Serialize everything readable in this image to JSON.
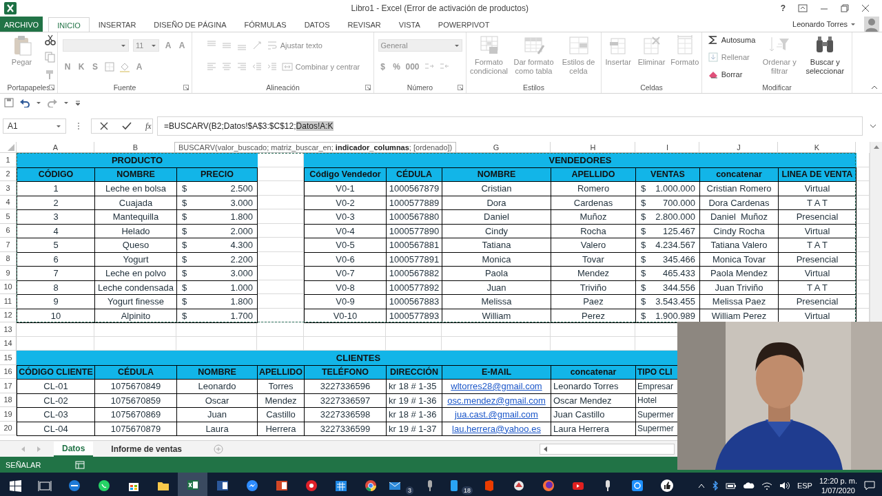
{
  "window": {
    "title": "Libro1 - Excel (Error de activación de productos)",
    "help": "?",
    "user": "Leonardo Torres"
  },
  "ribbon_tabs": [
    {
      "label": "ARCHIVO",
      "kind": "file",
      "selected": false
    },
    {
      "label": "INICIO",
      "kind": "tab",
      "selected": true
    },
    {
      "label": "INSERTAR",
      "kind": "tab",
      "selected": false
    },
    {
      "label": "DISEÑO DE PÁGINA",
      "kind": "tab",
      "selected": false
    },
    {
      "label": "FÓRMULAS",
      "kind": "tab",
      "selected": false
    },
    {
      "label": "DATOS",
      "kind": "tab",
      "selected": false
    },
    {
      "label": "REVISAR",
      "kind": "tab",
      "selected": false
    },
    {
      "label": "VISTA",
      "kind": "tab",
      "selected": false
    },
    {
      "label": "POWERPIVOT",
      "kind": "tab",
      "selected": false
    }
  ],
  "ribbon": [
    {
      "label": "Portapapeles",
      "blocks": [
        {
          "kind": "large",
          "label": "Pegar",
          "disabled": true
        },
        {
          "kind": "stack",
          "lines": [
            {
              "items": [
                {
                  "kind": "icon",
                  "disabled": false
                }
              ]
            },
            {
              "items": [
                {
                  "kind": "icon",
                  "disabled": true
                }
              ]
            },
            {
              "items": [
                {
                  "kind": "icon",
                  "disabled": true
                }
              ]
            }
          ]
        }
      ]
    },
    {
      "label": "Fuente",
      "blocks": [
        {
          "kind": "stack",
          "lines": [
            {
              "items": [
                {
                  "kind": "field",
                  "disabled": true
                },
                {
                  "kind": "field",
                  "value": "11",
                  "disabled": true
                },
                {
                  "kind": "text",
                  "label": "A",
                  "disabled": true
                },
                {
                  "kind": "text",
                  "label": "A",
                  "disabled": true
                }
              ]
            },
            {
              "items": [
                {
                  "kind": "text",
                  "label": "N",
                  "disabled": true
                },
                {
                  "kind": "text",
                  "label": "K",
                  "disabled": true
                },
                {
                  "kind": "text",
                  "label": "S",
                  "disabled": true
                },
                {
                  "kind": "icon",
                  "disabled": true
                },
                {
                  "kind": "icon",
                  "disabled": true
                },
                {
                  "kind": "text",
                  "label": "A",
                  "disabled": true
                }
              ]
            }
          ]
        }
      ]
    },
    {
      "label": "Alineación",
      "blocks": [
        {
          "kind": "stack",
          "lines": [
            {
              "items": [
                {
                  "kind": "icon",
                  "disabled": true
                },
                {
                  "kind": "icon",
                  "disabled": true
                },
                {
                  "kind": "icon",
                  "disabled": true
                },
                {
                  "kind": "icon",
                  "disabled": true
                },
                {
                  "kind": "small",
                  "label": "Ajustar texto",
                  "disabled": true
                }
              ]
            },
            {
              "items": [
                {
                  "kind": "icon",
                  "disabled": true
                },
                {
                  "kind": "icon",
                  "disabled": true
                },
                {
                  "kind": "icon",
                  "disabled": true
                },
                {
                  "kind": "icon",
                  "disabled": true
                },
                {
                  "kind": "icon",
                  "disabled": true
                },
                {
                  "kind": "small",
                  "label": "Combinar y centrar",
                  "disabled": true
                }
              ]
            }
          ]
        }
      ]
    },
    {
      "label": "Número",
      "blocks": [
        {
          "kind": "stack",
          "lines": [
            {
              "items": [
                {
                  "kind": "field",
                  "value": "General",
                  "disabled": true
                }
              ]
            },
            {
              "items": [
                {
                  "kind": "text",
                  "label": "$",
                  "disabled": true
                },
                {
                  "kind": "text",
                  "label": "%",
                  "disabled": true
                },
                {
                  "kind": "text",
                  "label": "000",
                  "disabled": true
                },
                {
                  "kind": "icon",
                  "disabled": true
                },
                {
                  "kind": "icon",
                  "disabled": true
                }
              ]
            }
          ]
        }
      ]
    },
    {
      "label": "Estilos",
      "blocks": [
        {
          "kind": "large",
          "label": "Formato condicional",
          "disabled": true
        },
        {
          "kind": "large",
          "label": "Dar formato como tabla",
          "disabled": true
        },
        {
          "kind": "large",
          "label": "Estilos de celda",
          "disabled": true
        }
      ]
    },
    {
      "label": "Celdas",
      "blocks": [
        {
          "kind": "large",
          "label": "Insertar",
          "disabled": true
        },
        {
          "kind": "large",
          "label": "Eliminar",
          "disabled": true
        },
        {
          "kind": "large",
          "label": "Formato",
          "disabled": true
        }
      ]
    },
    {
      "label": "Modificar",
      "blocks": [
        {
          "kind": "stack",
          "lines": [
            {
              "items": [
                {
                  "kind": "small",
                  "label": "Autosuma",
                  "disabled": false
                }
              ]
            },
            {
              "items": [
                {
                  "kind": "small",
                  "label": "Rellenar",
                  "disabled": true
                }
              ]
            },
            {
              "items": [
                {
                  "kind": "small",
                  "label": "Borrar",
                  "disabled": false
                }
              ]
            }
          ]
        },
        {
          "kind": "large",
          "label": "Ordenar y filtrar",
          "disabled": true
        },
        {
          "kind": "large",
          "label": "Buscar y seleccionar",
          "disabled": false
        }
      ]
    }
  ],
  "formula_bar": {
    "name_box": "A1",
    "function_button": "fx",
    "formula": "=BUSCARV(B2;Datos!$A$3:$C$12;",
    "selected_text": "Datos!A:K"
  },
  "tooltip": "BUSCARV(valor_buscado; matriz_buscar_en; **indicador_columnas**; [ordenado])",
  "sheet": {
    "column_letters_left": [
      "A",
      "B"
    ],
    "column_letters_right": [
      "G",
      "H",
      "I",
      "J",
      "K"
    ],
    "row_numbers": [
      "1",
      "2",
      "3",
      "4",
      "5",
      "6",
      "7",
      "8",
      "9",
      "10",
      "11",
      "12",
      "13",
      "14",
      "15",
      "16",
      "17",
      "18",
      "19",
      "20"
    ],
    "copy_marquee": true,
    "tables": [
      {
        "title": "PRODUCTO",
        "columns": [
          {
            "label": "CÓDIGO",
            "kind": "centered"
          },
          {
            "label": "NOMBRE",
            "kind": "centered"
          },
          {
            "label": "PRECIO",
            "kind": "money"
          }
        ],
        "rows": [
          [
            "1",
            "Leche en bolsa",
            {
              "currency": "$",
              "amount": "2.500"
            }
          ],
          [
            "2",
            "Cuajada",
            {
              "currency": "$",
              "amount": "3.000"
            }
          ],
          [
            "3",
            "Mantequilla",
            {
              "currency": "$",
              "amount": "1.800"
            }
          ],
          [
            "4",
            "Helado",
            {
              "currency": "$",
              "amount": "2.000"
            }
          ],
          [
            "5",
            "Queso",
            {
              "currency": "$",
              "amount": "4.300"
            }
          ],
          [
            "6",
            "Yogurt",
            {
              "currency": "$",
              "amount": "2.200"
            }
          ],
          [
            "7",
            "Leche en polvo",
            {
              "currency": "$",
              "amount": "3.000"
            }
          ],
          [
            "8",
            "Leche condensada",
            {
              "currency": "$",
              "amount": "1.000"
            }
          ],
          [
            "9",
            "Yogurt finesse",
            {
              "currency": "$",
              "amount": "1.800"
            }
          ],
          [
            "10",
            "Alpinito",
            {
              "currency": "$",
              "amount": "1.700"
            }
          ]
        ]
      },
      {
        "title": "VENDEDORES",
        "columns": [
          {
            "label": "Código Vendedor",
            "kind": "centered"
          },
          {
            "label": "CÉDULA",
            "kind": "centered"
          },
          {
            "label": "NOMBRE",
            "kind": "centered"
          },
          {
            "label": "APELLIDO",
            "kind": "centered"
          },
          {
            "label": "VENTAS",
            "kind": "money"
          },
          {
            "label": "concatenar",
            "kind": "centered"
          },
          {
            "label": "LINEA DE VENTA",
            "kind": "centered"
          }
        ],
        "rows": [
          [
            "V0-1",
            "1000567879",
            "Cristian",
            "Romero",
            {
              "currency": "$",
              "amount": "1.000.000"
            },
            "Cristian Romero",
            "Virtual"
          ],
          [
            "V0-2",
            "1000577889",
            "Dora",
            "Cardenas",
            {
              "currency": "$",
              "amount": "700.000"
            },
            "Dora Cardenas",
            "T A T"
          ],
          [
            "V0-3",
            "1000567880",
            "Daniel",
            "Muñoz",
            {
              "currency": "$",
              "amount": "2.800.000"
            },
            "Daniel  Muñoz",
            "Presencial"
          ],
          [
            "V0-4",
            "1000577890",
            "Cindy",
            "Rocha",
            {
              "currency": "$",
              "amount": "125.467"
            },
            "Cindy Rocha",
            "Virtual"
          ],
          [
            "V0-5",
            "1000567881",
            "Tatiana",
            "Valero",
            {
              "currency": "$",
              "amount": "4.234.567"
            },
            "Tatiana Valero",
            "T A T"
          ],
          [
            "V0-6",
            "1000577891",
            "Monica",
            "Tovar",
            {
              "currency": "$",
              "amount": "345.466"
            },
            "Monica Tovar",
            "Presencial"
          ],
          [
            "V0-7",
            "1000567882",
            "Paola",
            "Mendez",
            {
              "currency": "$",
              "amount": "465.433"
            },
            "Paola Mendez",
            "Virtual"
          ],
          [
            "V0-8",
            "1000577892",
            "Juan",
            "Triviño",
            {
              "currency": "$",
              "amount": "344.556"
            },
            "Juan Triviño",
            "T A T"
          ],
          [
            "V0-9",
            "1000567883",
            "Melissa",
            "Paez",
            {
              "currency": "$",
              "amount": "3.543.455"
            },
            "Melissa Paez",
            "Presencial"
          ],
          [
            "V0-10",
            "1000577893",
            "William",
            "Perez",
            {
              "currency": "$",
              "amount": "1.900.989"
            },
            "William Perez",
            "Virtual"
          ]
        ]
      },
      {
        "title": "CLIENTES",
        "columns": [
          {
            "label": "CÓDIGO CLIENTE",
            "kind": "centered"
          },
          {
            "label": "CÉDULA",
            "kind": "centered"
          },
          {
            "label": "NOMBRE",
            "kind": "centered"
          },
          {
            "label": "APELLIDO",
            "kind": "centered"
          },
          {
            "label": "TELÉFONO",
            "kind": "centered"
          },
          {
            "label": "DIRECCIÓN",
            "kind": "left"
          },
          {
            "label": "E-MAIL",
            "kind": "link"
          },
          {
            "label": "concatenar",
            "kind": "left"
          },
          {
            "label": "TIPO CLI",
            "kind": "left"
          }
        ],
        "rows": [
          [
            "CL-01",
            "1075670849",
            "Leonardo",
            "Torres",
            "3227336596",
            "kr 18 # 1-35",
            "wltorres28@gmail.com",
            "Leonardo Torres",
            "Empresar"
          ],
          [
            "CL-02",
            "1075670859",
            "Oscar",
            "Mendez",
            "3227336597",
            "kr 19 # 1-36",
            "osc.mendez@gmail.com",
            "Oscar Mendez",
            "Hotel"
          ],
          [
            "CL-03",
            "1075670869",
            "Juan",
            "Castillo",
            "3227336598",
            "kr 18 # 1-36",
            "jua.cast.@gmail.com",
            "Juan Castillo",
            "Supermer"
          ],
          [
            "CL-04",
            "1075670879",
            "Laura",
            "Herrera",
            "3227336599",
            "kr 19 # 1-37",
            "lau.herrera@yahoo.es",
            "Laura Herrera",
            "Supermer"
          ]
        ]
      }
    ]
  },
  "sheet_tabs": [
    {
      "label": "Datos",
      "selected": true
    },
    {
      "label": "Informe de ventas",
      "selected": false
    }
  ],
  "status_bar": {
    "mode": "SEÑALAR"
  },
  "taskbar": {
    "apps": [
      {
        "selected": false
      },
      {
        "selected": false
      },
      {
        "selected": false
      },
      {
        "selected": false
      },
      {
        "selected": false
      },
      {
        "selected": false
      },
      {
        "selected": true
      },
      {
        "selected": false
      },
      {
        "selected": false
      },
      {
        "selected": false
      },
      {
        "selected": false
      },
      {
        "selected": false
      },
      {
        "selected": false
      },
      {
        "selected": false,
        "badge": "3"
      },
      {
        "selected": false
      },
      {
        "selected": false,
        "badge": "18"
      },
      {
        "selected": false
      },
      {
        "selected": false
      },
      {
        "selected": false
      },
      {
        "selected": false
      },
      {
        "selected": false
      },
      {
        "selected": false
      },
      {
        "selected": false
      }
    ],
    "language": "ESP",
    "time": "12:20 p. m.",
    "date": "1/07/2020"
  }
}
